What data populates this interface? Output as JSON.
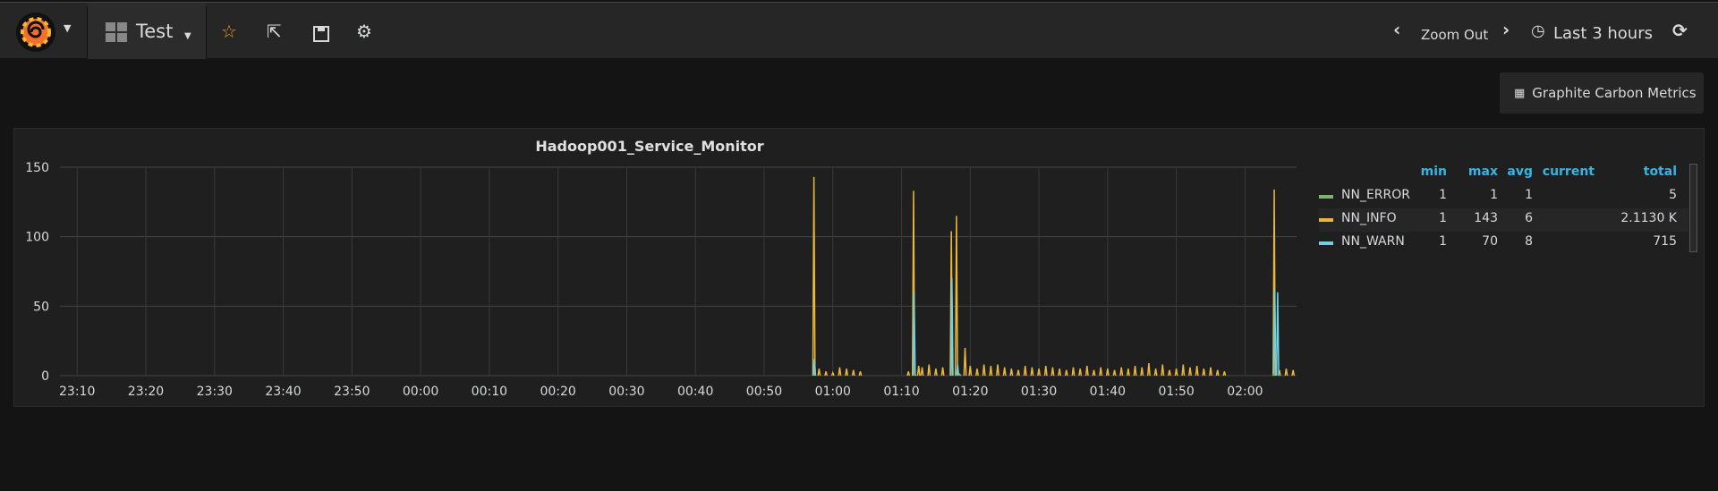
{
  "nav": {
    "logo": "grafana-logo",
    "dashboard_title": "Test",
    "zoom_out": "Zoom Out",
    "time_range": "Last 3 hours",
    "icons": [
      "star-icon",
      "share-icon",
      "save-icon",
      "gear-icon",
      "chevron-left-icon",
      "chevron-right-icon",
      "clock-icon",
      "refresh-icon"
    ]
  },
  "row_button": "Graphite Carbon Metrics",
  "panel": {
    "title": "Hadoop001_Service_Monitor",
    "legend": {
      "headers": [
        "min",
        "max",
        "avg",
        "current",
        "total"
      ],
      "rows": [
        {
          "name": "NN_ERROR",
          "min": "1",
          "max": "1",
          "avg": "1",
          "current": "",
          "total": "5",
          "color": "#7EB26D"
        },
        {
          "name": "NN_INFO",
          "min": "1",
          "max": "143",
          "avg": "6",
          "current": "",
          "total": "2.1130 K",
          "color": "#EAB839"
        },
        {
          "name": "NN_WARN",
          "min": "1",
          "max": "70",
          "avg": "8",
          "current": "",
          "total": "715",
          "color": "#6ED0E0"
        }
      ]
    }
  },
  "chart_data": {
    "type": "line",
    "title": "Hadoop001_Service_Monitor",
    "xlim": [
      "23:07:30",
      "02:07:30"
    ],
    "ylim": [
      0,
      150
    ],
    "grid": true,
    "legend": "right",
    "x_ticks": [
      "23:10",
      "23:20",
      "23:30",
      "23:40",
      "23:50",
      "00:00",
      "00:10",
      "00:20",
      "00:30",
      "00:40",
      "00:50",
      "01:00",
      "01:10",
      "01:20",
      "01:30",
      "01:40",
      "01:50",
      "02:00"
    ],
    "y_ticks": [
      0,
      50,
      100,
      150
    ],
    "series": [
      {
        "name": "NN_ERROR",
        "color": "#7EB26D",
        "points": [
          [
            "01:12:00",
            1
          ],
          [
            "01:18:00",
            1
          ],
          [
            "01:18:30",
            1
          ],
          [
            "02:04:10",
            1
          ],
          [
            "02:05:00",
            1
          ]
        ]
      },
      {
        "name": "NN_INFO",
        "color": "#EAB839",
        "points": [
          [
            "00:57:15",
            143
          ],
          [
            "00:58:00",
            5
          ],
          [
            "00:59:00",
            3
          ],
          [
            "01:00:00",
            2
          ],
          [
            "01:01:00",
            6
          ],
          [
            "01:02:00",
            5
          ],
          [
            "01:03:00",
            4
          ],
          [
            "01:04:00",
            3
          ],
          [
            "01:11:00",
            3
          ],
          [
            "01:11:45",
            133
          ],
          [
            "01:12:30",
            7
          ],
          [
            "01:13:00",
            6
          ],
          [
            "01:14:00",
            8
          ],
          [
            "01:15:00",
            5
          ],
          [
            "01:16:00",
            6
          ],
          [
            "01:17:15",
            104
          ],
          [
            "01:18:00",
            115
          ],
          [
            "01:19:15",
            20
          ],
          [
            "01:20:00",
            7
          ],
          [
            "01:21:00",
            5
          ],
          [
            "01:22:00",
            8
          ],
          [
            "01:23:00",
            7
          ],
          [
            "01:24:00",
            8
          ],
          [
            "01:25:00",
            6
          ],
          [
            "01:26:00",
            5
          ],
          [
            "01:27:00",
            4
          ],
          [
            "01:28:00",
            7
          ],
          [
            "01:29:00",
            6
          ],
          [
            "01:30:00",
            5
          ],
          [
            "01:31:00",
            7
          ],
          [
            "01:32:00",
            6
          ],
          [
            "01:33:00",
            5
          ],
          [
            "01:34:00",
            4
          ],
          [
            "01:35:00",
            6
          ],
          [
            "01:36:00",
            5
          ],
          [
            "01:37:00",
            7
          ],
          [
            "01:38:00",
            4
          ],
          [
            "01:39:00",
            6
          ],
          [
            "01:40:00",
            5
          ],
          [
            "01:41:00",
            4
          ],
          [
            "01:42:00",
            6
          ],
          [
            "01:43:00",
            5
          ],
          [
            "01:44:00",
            7
          ],
          [
            "01:45:00",
            6
          ],
          [
            "01:46:00",
            9
          ],
          [
            "01:47:00",
            5
          ],
          [
            "01:48:00",
            8
          ],
          [
            "01:49:00",
            4
          ],
          [
            "01:50:00",
            5
          ],
          [
            "01:51:00",
            8
          ],
          [
            "01:52:00",
            6
          ],
          [
            "01:53:00",
            7
          ],
          [
            "01:54:00",
            5
          ],
          [
            "01:55:00",
            6
          ],
          [
            "01:56:00",
            4
          ],
          [
            "01:57:00",
            3
          ],
          [
            "02:04:15",
            134
          ],
          [
            "02:05:00",
            4
          ],
          [
            "02:06:00",
            5
          ],
          [
            "02:07:00",
            4
          ]
        ]
      },
      {
        "name": "NN_WARN",
        "color": "#6ED0E0",
        "points": [
          [
            "00:57:20",
            12
          ],
          [
            "01:11:50",
            60
          ],
          [
            "01:17:20",
            70
          ],
          [
            "01:18:10",
            8
          ],
          [
            "02:04:20",
            62
          ],
          [
            "02:04:45",
            60
          ]
        ]
      }
    ]
  }
}
